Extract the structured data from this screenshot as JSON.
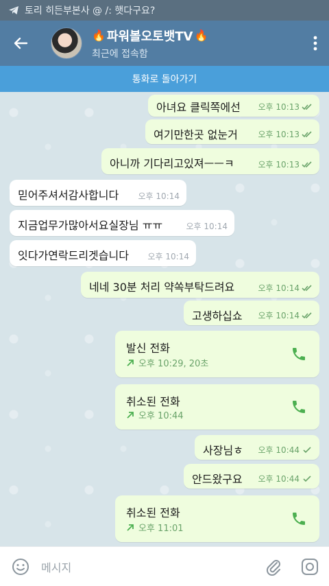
{
  "status_bar": {
    "notification_text": "토리 히든부본사 @ /: 햇다구요?"
  },
  "header": {
    "name_prefix_emoji": "🔥",
    "name": "파워볼오토뱃TV",
    "name_suffix_emoji": "🔥",
    "status": "최근에 접속함"
  },
  "call_banner": {
    "label": "통화로 돌아가기"
  },
  "messages": [
    {
      "text": "아녀요 클릭쪽에선",
      "time": "오후 10:13"
    },
    {
      "text": "여기만한곳 없눈거",
      "time": "오후 10:13"
    },
    {
      "text": "아니까 기다리고있져ㅡㅡㅋ",
      "time": "오후 10:13"
    },
    {
      "text": "믿어주셔서감사합니다",
      "time": "오후 10:14"
    },
    {
      "text": "지금업무가많아서요실장님 ㅠㅠ",
      "time": "오후 10:14"
    },
    {
      "text": "잇다가연락드리겟습니다",
      "time": "오후 10:14"
    },
    {
      "text": "네네 30분 처리 약쏙부탁드려요",
      "time": "오후 10:14"
    },
    {
      "text": "고생하십쇼",
      "time": "오후 10:14"
    },
    {
      "text": "사장님ㅎ",
      "time": "오후 10:44"
    },
    {
      "text": "안드왔구요",
      "time": "오후 10:44"
    }
  ],
  "calls": [
    {
      "title": "발신 전화",
      "detail": "오후 10:29, 20초"
    },
    {
      "title": "취소된 전화",
      "detail": "오후 10:44"
    },
    {
      "title": "취소된 전화",
      "detail": "오후 11:01"
    }
  ],
  "composer": {
    "placeholder": "메시지"
  },
  "colors": {
    "header": "#527da3",
    "call_banner": "#4a9fda",
    "outgoing_bubble": "#effdde",
    "incoming_bubble": "#ffffff",
    "check_green": "#6aa36a",
    "phone_green": "#4caf50"
  }
}
